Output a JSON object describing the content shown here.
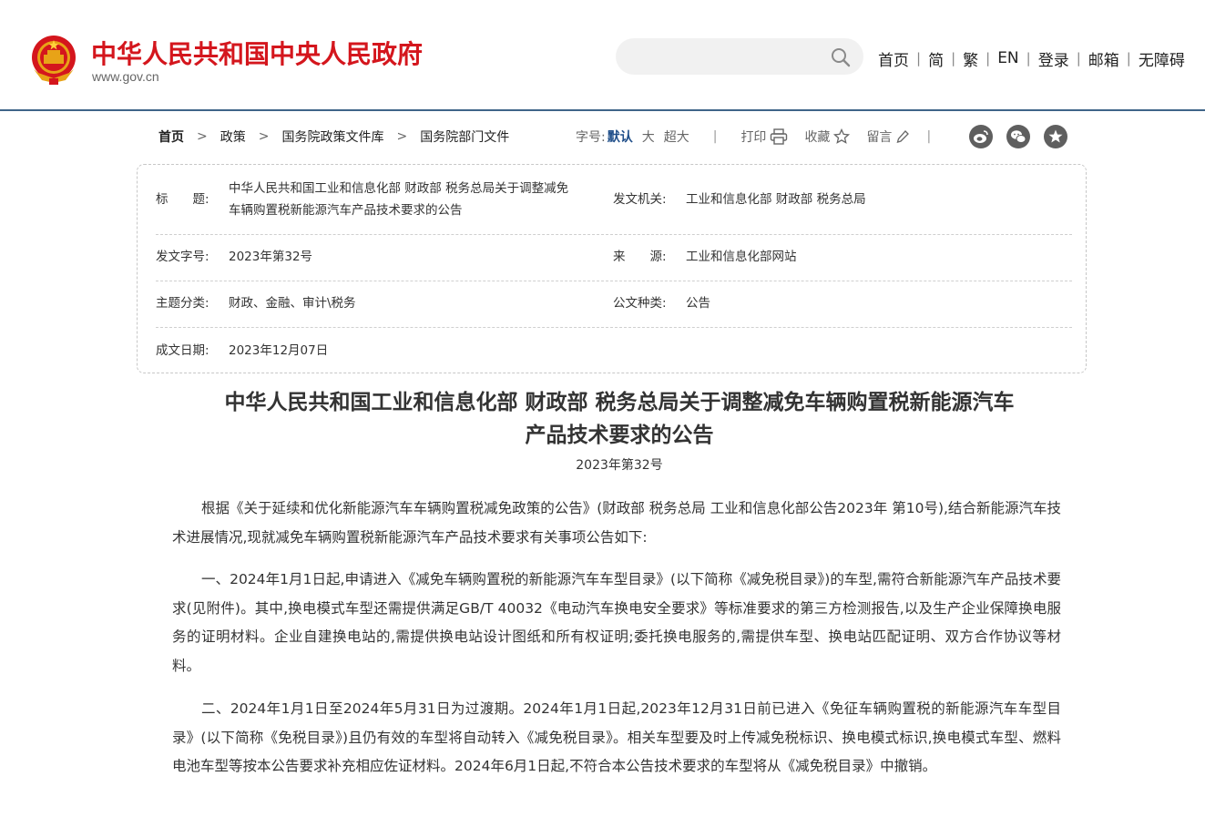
{
  "header": {
    "site_title": "中华人民共和国中央人民政府",
    "site_domain": "www.gov.cn",
    "search_placeholder": "",
    "nav": [
      "首页",
      "简",
      "繁",
      "EN",
      "登录",
      "邮箱",
      "无障碍"
    ],
    "nav_separator": "|"
  },
  "breadcrumb": {
    "items": [
      "首页",
      "政策",
      "国务院政策文件库",
      "国务院部门文件"
    ]
  },
  "tools": {
    "font_size_label": "字号:",
    "font_default": "默认",
    "font_large": "大",
    "font_xlarge": "超大",
    "print": "打印",
    "favorite": "收藏",
    "comment": "留言",
    "share_icons": [
      "weibo-icon",
      "wechat-icon",
      "star-icon"
    ]
  },
  "meta": {
    "title_label": "标　　题:",
    "title_value_line1": "中华人民共和国工业和信息化部 财政部 税务总局关于调整减免",
    "title_value_line2": "车辆购置税新能源汽车产品技术要求的公告",
    "issuer_label": "发文机关:",
    "issuer_value": "工业和信息化部 财政部 税务总局",
    "doc_no_label": "发文字号:",
    "doc_no_value": "2023年第32号",
    "source_label": "来　　源:",
    "source_value": "工业和信息化部网站",
    "category_label": "主题分类:",
    "category_value": "财政、金融、审计\\税务",
    "type_label": "公文种类:",
    "type_value": "公告",
    "date_label": "成文日期:",
    "date_value": "2023年12月07日"
  },
  "article": {
    "title_line1": "中华人民共和国工业和信息化部 财政部 税务总局关于调整减免车辆购置税新能源汽车",
    "title_line2": "产品技术要求的公告",
    "number": "2023年第32号",
    "paragraphs": [
      "根据《关于延续和优化新能源汽车车辆购置税减免政策的公告》(财政部 税务总局 工业和信息化部公告2023年 第10号),结合新能源汽车技术进展情况,现就减免车辆购置税新能源汽车产品技术要求有关事项公告如下:",
      "一、2024年1月1日起,申请进入《减免车辆购置税的新能源汽车车型目录》(以下简称《减免税目录》)的车型,需符合新能源汽车产品技术要求(见附件)。其中,换电模式车型还需提供满足GB/T 40032《电动汽车换电安全要求》等标准要求的第三方检测报告,以及生产企业保障换电服务的证明材料。企业自建换电站的,需提供换电站设计图纸和所有权证明;委托换电服务的,需提供车型、换电站匹配证明、双方合作协议等材料。",
      "二、2024年1月1日至2024年5月31日为过渡期。2024年1月1日起,2023年12月31日前已进入《免征车辆购置税的新能源汽车车型目录》(以下简称《免税目录》)且仍有效的车型将自动转入《减免税目录》。相关车型要及时上传减免税标识、换电模式标识,换电模式车型、燃料电池车型等按本公告要求补充相应佐证材料。2024年6月1日起,不符合本公告技术要求的车型将从《减免税目录》中撤销。"
    ]
  },
  "colors": {
    "brand_red": "#d4161d",
    "header_rule": "#3f6589",
    "active_font": "#1f4e89"
  }
}
